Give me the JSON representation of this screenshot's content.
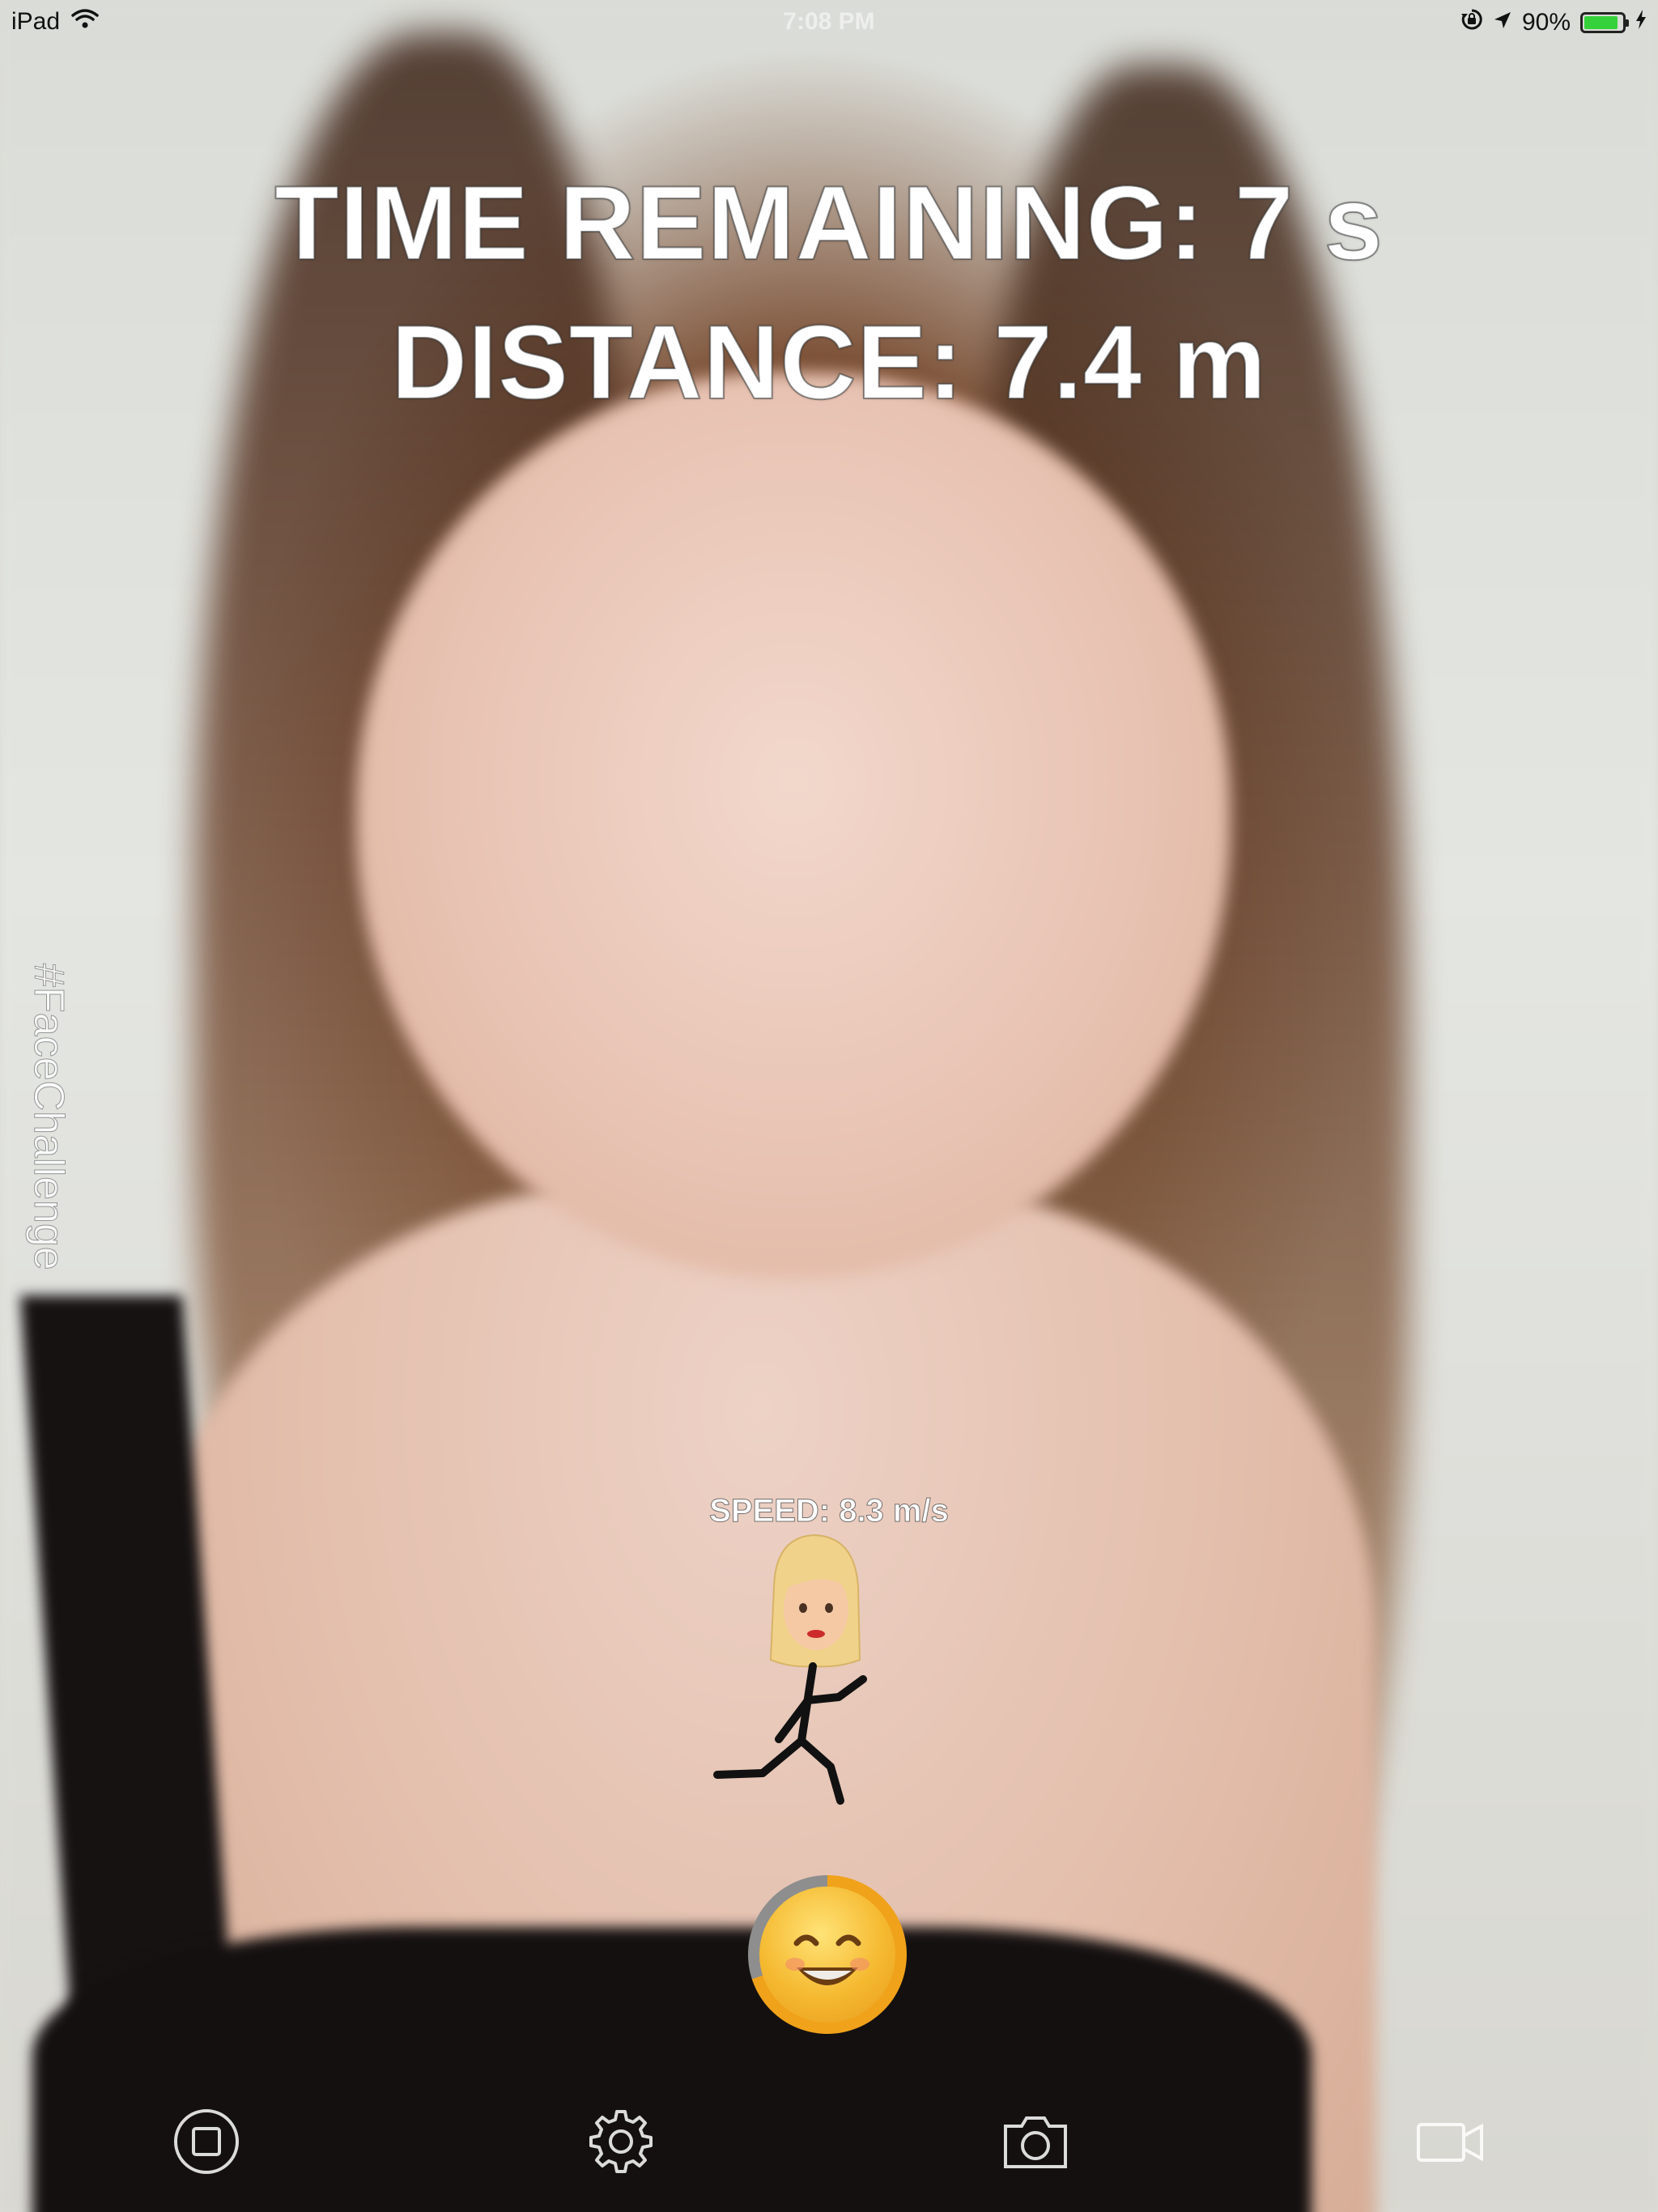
{
  "status_bar": {
    "device": "iPad",
    "time": "7:08 PM",
    "battery_percent": "90%",
    "battery_level": 0.9,
    "icons": [
      "wifi-icon",
      "rotation-lock-icon",
      "location-arrow-icon",
      "battery-icon",
      "charging-bolt-icon"
    ]
  },
  "hud": {
    "time_remaining": "TIME REMAINING: 7 s",
    "distance": "DISTANCE: 7.4 m",
    "speed": "SPEED: 8.3 m/s",
    "hashtag": "#FaceChallenge"
  },
  "game": {
    "smile_meter_level": 0.7,
    "runner_avatar": "blonde-woman-emoji",
    "smile_button_icon": "smiling-face-icon"
  },
  "toolbar": {
    "icons": [
      "stop-icon",
      "gear-icon",
      "camera-icon",
      "video-camera-icon"
    ]
  },
  "colors": {
    "hud_text": "#ffffff",
    "battery_green": "#35d13b",
    "smile_meter": "#f0a21a"
  }
}
